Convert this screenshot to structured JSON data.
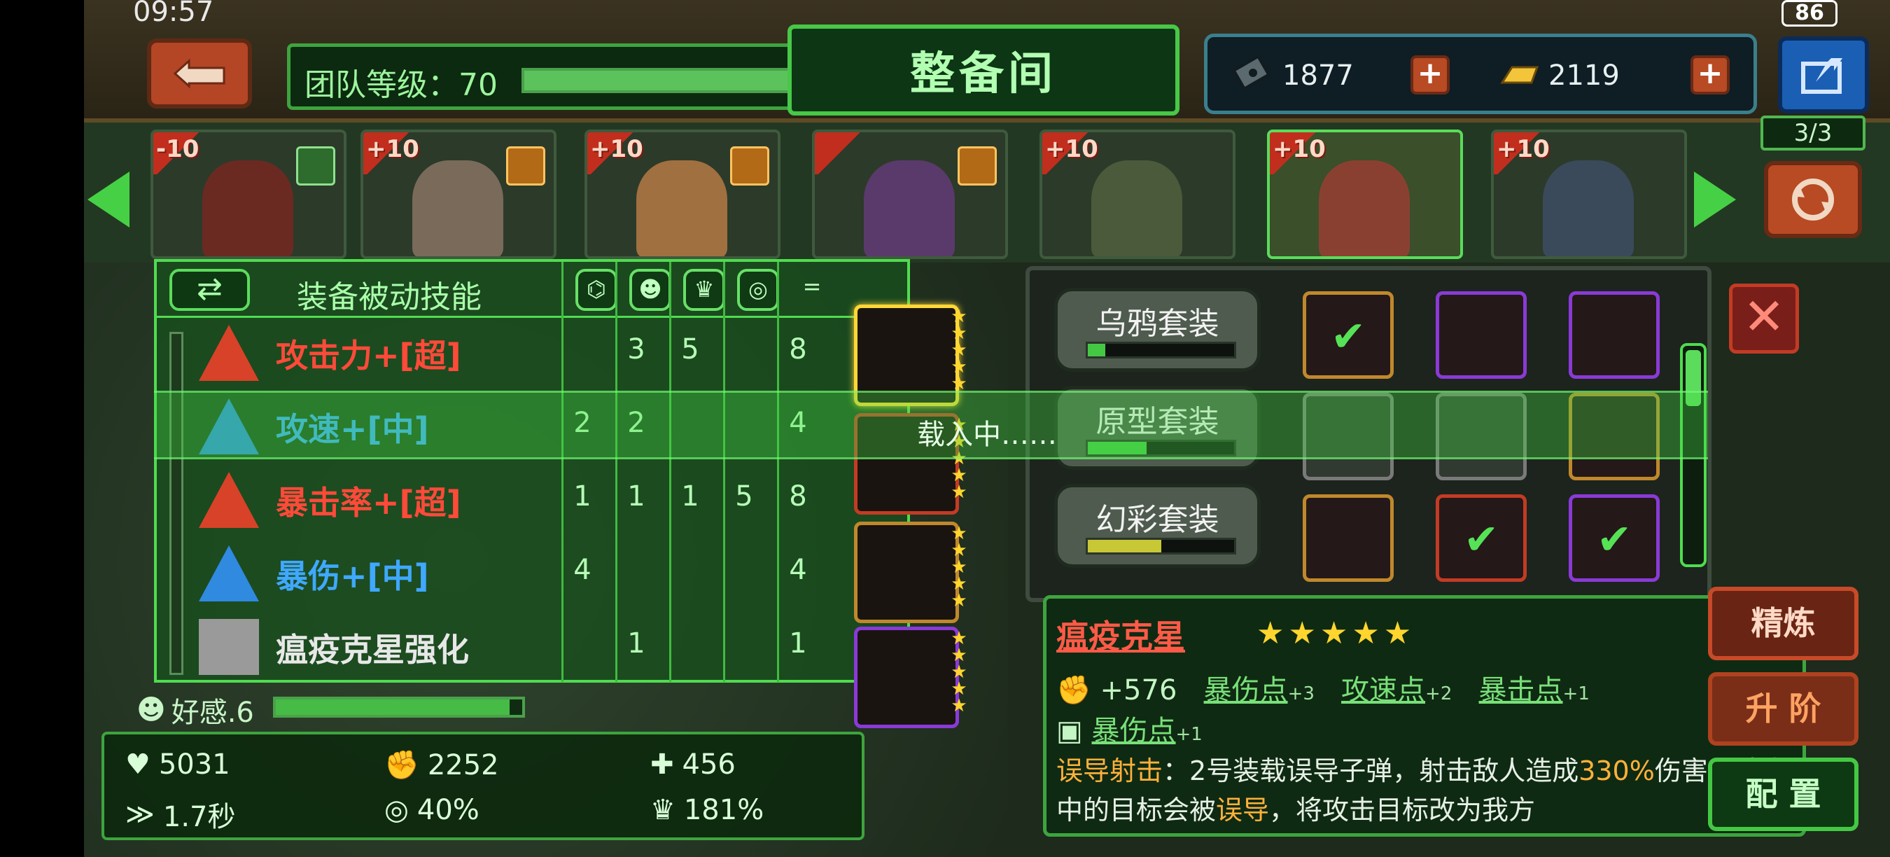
{
  "status": {
    "time": "09:57",
    "battery": "86"
  },
  "header": {
    "team_label": "团队等级：70",
    "team_progress": 0.92,
    "title": "整备间",
    "currency1": "1877",
    "currency2": "2119",
    "team_count": "3/3"
  },
  "heroes": [
    {
      "level": "-10",
      "role": "green"
    },
    {
      "level": "+10",
      "role": "orange"
    },
    {
      "level": "+10",
      "role": "orange"
    },
    {
      "level": "",
      "role": "orange"
    },
    {
      "level": "+10",
      "role": ""
    },
    {
      "level": "+10",
      "role": "",
      "selected": true
    },
    {
      "level": "+10",
      "role": ""
    }
  ],
  "passive": {
    "title": "装备被动技能",
    "swap": "⇄",
    "col_last": "=",
    "skills": [
      {
        "name": "攻击力+[超]",
        "color": "#ff4a3a",
        "vals": [
          "",
          "3",
          "5",
          "",
          "8"
        ]
      },
      {
        "name": "攻速+[中]",
        "color": "#3fa8ff",
        "vals": [
          "2",
          "2",
          "",
          "",
          "4"
        ]
      },
      {
        "name": "暴击率+[超]",
        "color": "#ff4a3a",
        "vals": [
          "1",
          "1",
          "1",
          "5",
          "8"
        ]
      },
      {
        "name": "暴伤+[中]",
        "color": "#3fa8ff",
        "vals": [
          "4",
          "",
          "",
          "",
          "4"
        ]
      },
      {
        "name": "瘟疫克星强化",
        "color": "#e8e8e8",
        "vals": [
          "",
          "1",
          "",
          "",
          "1"
        ]
      }
    ]
  },
  "affection": {
    "label": "好感.6",
    "progress": 0.95
  },
  "stats": {
    "hp": "5031",
    "atk": "2252",
    "def": "456",
    "speed": "1.7秒",
    "crit": "40%",
    "crit_dmg": "181%"
  },
  "loading": "载入中……",
  "sets": [
    {
      "name": "乌鸦套装",
      "fill": 0.12,
      "color": "#44c844"
    },
    {
      "name": "原型套装",
      "fill": 0.4,
      "color": "#44c844"
    },
    {
      "name": "幻彩套装",
      "fill": 0.5,
      "color": "#c8c836"
    }
  ],
  "detail": {
    "name": "瘟疫克星",
    "stars": "★★★★★",
    "atk_bonus": "+576",
    "attr1": "暴伤点",
    "attr1_sup": "+3",
    "attr2": "攻速点",
    "attr2_sup": "+2",
    "attr3": "暴击点",
    "attr3_sup": "+1",
    "attr4": "暴伤点",
    "attr4_sup": "+1",
    "skill_name": "误导射击",
    "desc_a": "：2号装载误导子弹，射击敌人造成",
    "desc_pct": "330%",
    "desc_b": "伤害。被击中的目标会被",
    "desc_mis": "误导",
    "desc_c": "，将攻击目标改为我方"
  },
  "actions": {
    "refine": "精炼",
    "upgrade": "升 阶",
    "config": "配 置"
  },
  "close": "✕",
  "colors": {
    "accent": "#4fdc4f",
    "danger": "#c33b24"
  }
}
